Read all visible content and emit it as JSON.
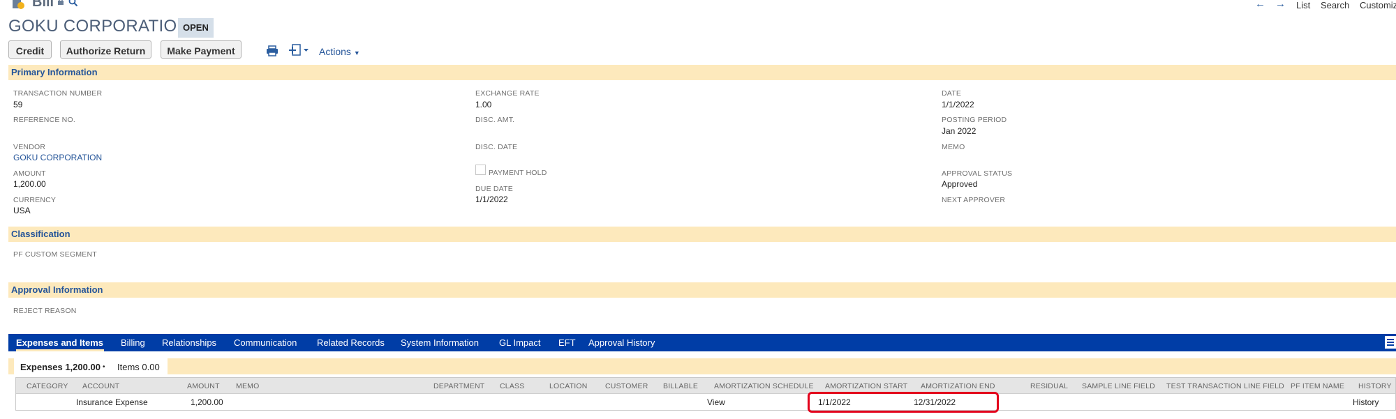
{
  "header": {
    "record_type": "Bill",
    "title": "GOKU CORPORATION",
    "status": "OPEN",
    "nav": {
      "list": "List",
      "search": "Search",
      "customize": "Customiz"
    }
  },
  "toolbar": {
    "credit": "Credit",
    "authorize_return": "Authorize Return",
    "make_payment": "Make Payment",
    "actions": "Actions"
  },
  "primary": {
    "heading": "Primary Information",
    "transaction_number": {
      "label": "TRANSACTION NUMBER",
      "value": "59"
    },
    "reference_no": {
      "label": "REFERENCE NO."
    },
    "vendor": {
      "label": "VENDOR",
      "value": "GOKU CORPORATION"
    },
    "amount": {
      "label": "AMOUNT",
      "value": "1,200.00"
    },
    "currency": {
      "label": "CURRENCY",
      "value": "USA"
    },
    "exchange_rate": {
      "label": "EXCHANGE RATE",
      "value": "1.00"
    },
    "disc_amt": {
      "label": "DISC. AMT."
    },
    "disc_date": {
      "label": "DISC. DATE"
    },
    "payment_hold": {
      "label": "PAYMENT HOLD",
      "checked": false
    },
    "due_date": {
      "label": "DUE DATE",
      "value": "1/1/2022"
    },
    "date": {
      "label": "DATE",
      "value": "1/1/2022"
    },
    "posting_period": {
      "label": "POSTING PERIOD",
      "value": "Jan 2022"
    },
    "memo": {
      "label": "MEMO"
    },
    "approval_status": {
      "label": "APPROVAL STATUS",
      "value": "Approved"
    },
    "next_approver": {
      "label": "NEXT APPROVER"
    }
  },
  "classification": {
    "heading": "Classification",
    "pf_custom_segment": {
      "label": "PF CUSTOM SEGMENT"
    }
  },
  "approval": {
    "heading": "Approval Information",
    "reject_reason": {
      "label": "REJECT REASON"
    }
  },
  "tabs": [
    {
      "label": "Expenses and Items"
    },
    {
      "label": "Billing"
    },
    {
      "label": "Relationships"
    },
    {
      "label": "Communication"
    },
    {
      "label": "Related Records"
    },
    {
      "label": "System Information"
    },
    {
      "label": "GL Impact"
    },
    {
      "label": "EFT"
    },
    {
      "label": "Approval History"
    }
  ],
  "subtabs": {
    "expenses": "Expenses 1,200.00",
    "dot": "•",
    "items": "Items 0.00"
  },
  "table": {
    "columns": [
      "CATEGORY",
      "ACCOUNT",
      "AMOUNT",
      "MEMO",
      "DEPARTMENT",
      "CLASS",
      "LOCATION",
      "CUSTOMER",
      "BILLABLE",
      "AMORTIZATION SCHEDULE",
      "AMORTIZATION START",
      "AMORTIZATION END",
      "RESIDUAL",
      "SAMPLE LINE FIELD",
      "TEST TRANSACTION LINE FIELD",
      "PF ITEM NAME",
      "HISTORY"
    ],
    "rows": [
      {
        "account": "Insurance Expense",
        "amount": "1,200.00",
        "amortization_schedule": "View",
        "amortization_start": "1/1/2022",
        "amortization_end": "12/31/2022",
        "history": "History"
      }
    ]
  },
  "colors": {
    "accent": "#255599",
    "tabbar": "#003da6",
    "section": "#fde9bc",
    "highlight": "#e3001b"
  }
}
